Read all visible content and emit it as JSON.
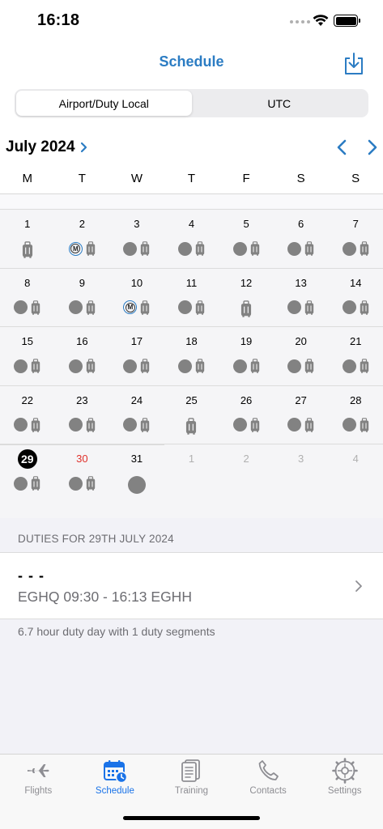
{
  "status_bar": {
    "time": "16:18"
  },
  "nav": {
    "title": "Schedule"
  },
  "segments": [
    {
      "label": "Airport/Duty Local",
      "active": true
    },
    {
      "label": "UTC",
      "active": false
    }
  ],
  "calendar": {
    "month_label": "July 2024",
    "weekdays": [
      "M",
      "T",
      "W",
      "T",
      "F",
      "S",
      "S"
    ],
    "weeks": [
      [
        {
          "num": "1",
          "icons": [
            "bag-large"
          ]
        },
        {
          "num": "2",
          "icons": [
            "m-badge",
            "bag"
          ]
        },
        {
          "num": "3",
          "icons": [
            "dot",
            "bag"
          ]
        },
        {
          "num": "4",
          "icons": [
            "dot",
            "bag"
          ]
        },
        {
          "num": "5",
          "icons": [
            "dot",
            "bag"
          ]
        },
        {
          "num": "6",
          "icons": [
            "dot",
            "bag"
          ]
        },
        {
          "num": "7",
          "icons": [
            "dot",
            "bag"
          ]
        }
      ],
      [
        {
          "num": "8",
          "icons": [
            "dot",
            "bag"
          ]
        },
        {
          "num": "9",
          "icons": [
            "dot",
            "bag"
          ]
        },
        {
          "num": "10",
          "icons": [
            "m-badge",
            "bag"
          ]
        },
        {
          "num": "11",
          "icons": [
            "dot",
            "bag"
          ]
        },
        {
          "num": "12",
          "icons": [
            "bag-large"
          ]
        },
        {
          "num": "13",
          "icons": [
            "dot",
            "bag"
          ]
        },
        {
          "num": "14",
          "icons": [
            "dot",
            "bag"
          ]
        }
      ],
      [
        {
          "num": "15",
          "icons": [
            "dot",
            "bag"
          ]
        },
        {
          "num": "16",
          "icons": [
            "dot",
            "bag"
          ]
        },
        {
          "num": "17",
          "icons": [
            "dot",
            "bag"
          ]
        },
        {
          "num": "18",
          "icons": [
            "dot",
            "bag"
          ]
        },
        {
          "num": "19",
          "icons": [
            "dot",
            "bag"
          ]
        },
        {
          "num": "20",
          "icons": [
            "dot",
            "bag"
          ]
        },
        {
          "num": "21",
          "icons": [
            "dot",
            "bag"
          ]
        }
      ],
      [
        {
          "num": "22",
          "icons": [
            "dot",
            "bag"
          ]
        },
        {
          "num": "23",
          "icons": [
            "dot",
            "bag"
          ]
        },
        {
          "num": "24",
          "icons": [
            "dot",
            "bag"
          ]
        },
        {
          "num": "25",
          "icons": [
            "bag-large"
          ]
        },
        {
          "num": "26",
          "icons": [
            "dot",
            "bag"
          ]
        },
        {
          "num": "27",
          "icons": [
            "dot",
            "bag"
          ]
        },
        {
          "num": "28",
          "icons": [
            "dot",
            "bag"
          ]
        }
      ],
      [
        {
          "num": "29",
          "icons": [
            "dot",
            "bag"
          ],
          "style": "today"
        },
        {
          "num": "30",
          "icons": [
            "dot",
            "bag"
          ],
          "style": "red"
        },
        {
          "num": "31",
          "icons": [
            "dot-large"
          ]
        },
        {
          "num": "1",
          "icons": [],
          "style": "muted"
        },
        {
          "num": "2",
          "icons": [],
          "style": "muted"
        },
        {
          "num": "3",
          "icons": [],
          "style": "muted"
        },
        {
          "num": "4",
          "icons": [],
          "style": "muted"
        }
      ]
    ]
  },
  "duties": {
    "header": "DUTIES FOR 29TH JULY 2024",
    "items": [
      {
        "title": "- - -",
        "route": "EGHQ 09:30 - 16:13 EGHH"
      }
    ],
    "footer": "6.7 hour duty day with 1 duty segments"
  },
  "tabs": [
    {
      "label": "Flights",
      "icon": "airplane-icon",
      "active": false
    },
    {
      "label": "Schedule",
      "icon": "calendar-icon",
      "active": true
    },
    {
      "label": "Training",
      "icon": "document-icon",
      "active": false
    },
    {
      "label": "Contacts",
      "icon": "phone-icon",
      "active": false
    },
    {
      "label": "Settings",
      "icon": "gear-icon",
      "active": false
    }
  ],
  "colors": {
    "accent": "#2b7cc3",
    "tab_active": "#1a73e8",
    "marker_gray": "#828282",
    "weekend_red": "#e0312b"
  }
}
